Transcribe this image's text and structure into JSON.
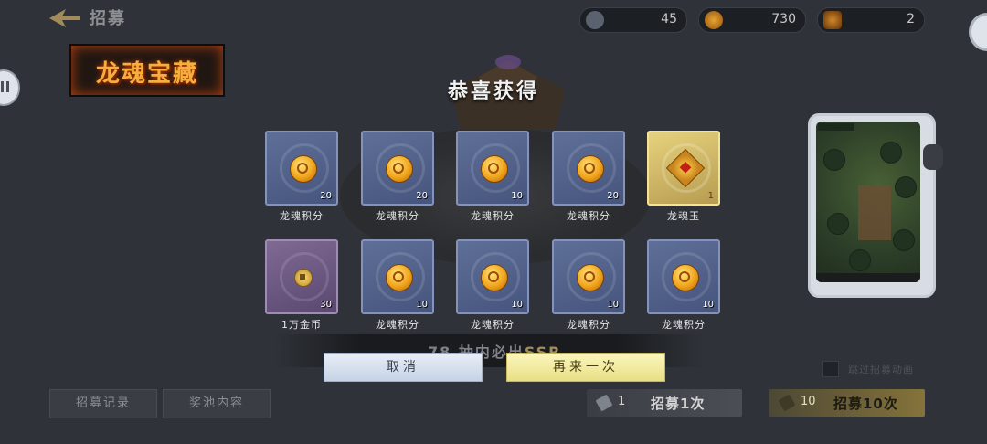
{
  "header": {
    "title": "招募"
  },
  "resources": [
    {
      "icon": "ticket-icon",
      "value": "45"
    },
    {
      "icon": "coin-icon",
      "value": "730"
    },
    {
      "icon": "gem-icon",
      "value": "2"
    }
  ],
  "banner": {
    "title": "龙魂宝藏"
  },
  "reward": {
    "title": "恭喜获得",
    "items": [
      {
        "name": "龙魂积分",
        "qty": "20",
        "rarity": "blue",
        "icon": "dragon-soul-coin-icon"
      },
      {
        "name": "龙魂积分",
        "qty": "20",
        "rarity": "blue",
        "icon": "dragon-soul-coin-icon"
      },
      {
        "name": "龙魂积分",
        "qty": "10",
        "rarity": "blue",
        "icon": "dragon-soul-coin-icon"
      },
      {
        "name": "龙魂积分",
        "qty": "20",
        "rarity": "blue",
        "icon": "dragon-soul-coin-icon"
      },
      {
        "name": "龙魂玉",
        "qty": "1",
        "rarity": "gold",
        "icon": "dragon-soul-jade-icon"
      },
      {
        "name": "1万金币",
        "qty": "30",
        "rarity": "purple",
        "icon": "gold-coin-icon"
      },
      {
        "name": "龙魂积分",
        "qty": "10",
        "rarity": "blue",
        "icon": "dragon-soul-coin-icon"
      },
      {
        "name": "龙魂积分",
        "qty": "10",
        "rarity": "blue",
        "icon": "dragon-soul-coin-icon"
      },
      {
        "name": "龙魂积分",
        "qty": "10",
        "rarity": "blue",
        "icon": "dragon-soul-coin-icon"
      },
      {
        "name": "龙魂积分",
        "qty": "10",
        "rarity": "blue",
        "icon": "dragon-soul-coin-icon"
      }
    ],
    "cancel_label": "取消",
    "again_label": "再来一次"
  },
  "guarantee": {
    "prefix": "78 抽内必出",
    "highlight": "SSR"
  },
  "skip_animation_label": "跳过招募动画",
  "bottom": {
    "history_label": "招募记录",
    "pool_label": "奖池内容",
    "recruit_one": {
      "cost": "1",
      "label": "招募1次"
    },
    "recruit_ten": {
      "cost": "10",
      "label": "招募10次"
    }
  },
  "colors": {
    "accent_gold": "#e9df85",
    "card_blue": "#4b5a82",
    "card_gold": "#d9c46f",
    "card_purple": "#6b5781"
  }
}
